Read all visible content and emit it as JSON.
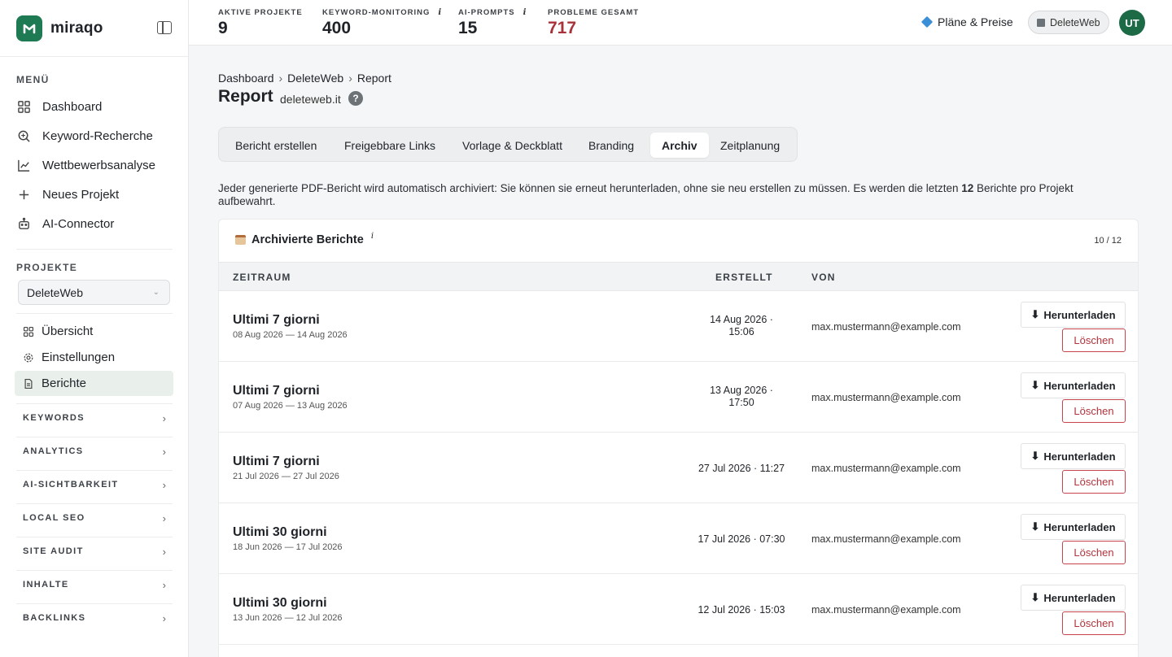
{
  "brand": {
    "name": "miraqo"
  },
  "sidebar": {
    "menu_label": "MENÜ",
    "menu": [
      {
        "label": "Dashboard",
        "icon": "grid-icon"
      },
      {
        "label": "Keyword-Recherche",
        "icon": "search-icon"
      },
      {
        "label": "Wettbewerbsanalyse",
        "icon": "chart-line-icon"
      },
      {
        "label": "Neues Projekt",
        "icon": "plus-icon"
      },
      {
        "label": "AI-Connector",
        "icon": "robot-icon"
      }
    ],
    "projects_label": "PROJEKTE",
    "project_select": "DeleteWeb",
    "sub_items": [
      {
        "label": "Übersicht",
        "icon": "grid-icon"
      },
      {
        "label": "Einstellungen",
        "icon": "gear-icon"
      },
      {
        "label": "Berichte",
        "icon": "document-icon"
      }
    ],
    "groups": [
      "KEYWORDS",
      "ANALYTICS",
      "AI-SICHTBARKEIT",
      "LOCAL SEO",
      "SITE AUDIT",
      "INHALTE",
      "BACKLINKS"
    ]
  },
  "topbar": {
    "stats": [
      {
        "label": "AKTIVE PROJEKTE",
        "value": "9",
        "info": false
      },
      {
        "label": "KEYWORD-MONITORING",
        "value": "400",
        "info": true
      },
      {
        "label": "AI-PROMPTS",
        "value": "15",
        "info": true
      },
      {
        "label": "PROBLEME GESAMT",
        "value": "717",
        "info": false,
        "color": "#a8323a"
      }
    ],
    "info_glyph": "i",
    "plans": "Pläne & Preise",
    "project_pill": "DeleteWeb",
    "avatar": "UT"
  },
  "breadcrumb": [
    "Dashboard",
    "DeleteWeb",
    "Report"
  ],
  "page": {
    "title": "Report",
    "domain": "deleteweb.it",
    "help": "?"
  },
  "tabs": [
    "Bericht erstellen",
    "Freigebbare Links",
    "Vorlage & Deckblatt",
    "Branding",
    "Archiv",
    "Zeitplanung"
  ],
  "active_tab": "Archiv",
  "description": {
    "before": "Jeder generierte PDF-Bericht wird automatisch archiviert: Sie können sie erneut herunterladen, ohne sie neu erstellen zu müssen. Es werden die letzten ",
    "bold": "12",
    "after": " Berichte pro Projekt aufbewahrt."
  },
  "archive": {
    "title": "Archivierte Berichte",
    "count": "10 / 12",
    "columns": [
      "ZEITRAUM",
      "ERSTELLT",
      "VON"
    ],
    "download_label": "Herunterladen",
    "delete_label": "Löschen",
    "rows": [
      {
        "title": "Ultimi 7 giorni",
        "range": "08 Aug 2026 — 14 Aug 2026",
        "created": "14 Aug 2026 · 15:06",
        "by": "max.mustermann@example.com"
      },
      {
        "title": "Ultimi 7 giorni",
        "range": "07 Aug 2026 — 13 Aug 2026",
        "created": "13 Aug 2026 · 17:50",
        "by": "max.mustermann@example.com"
      },
      {
        "title": "Ultimi 7 giorni",
        "range": "21 Jul 2026 — 27 Jul 2026",
        "created": "27 Jul 2026 · 11:27",
        "by": "max.mustermann@example.com"
      },
      {
        "title": "Ultimi 30 giorni",
        "range": "18 Jun 2026 — 17 Jul 2026",
        "created": "17 Jul 2026 · 07:30",
        "by": "max.mustermann@example.com"
      },
      {
        "title": "Ultimi 30 giorni",
        "range": "13 Jun 2026 — 12 Jul 2026",
        "created": "12 Jul 2026 · 15:03",
        "by": "max.mustermann@example.com"
      }
    ]
  },
  "colors": {
    "brand": "#1d7a52",
    "danger": "#b3333b",
    "active_bg": "#e9f0ec"
  }
}
